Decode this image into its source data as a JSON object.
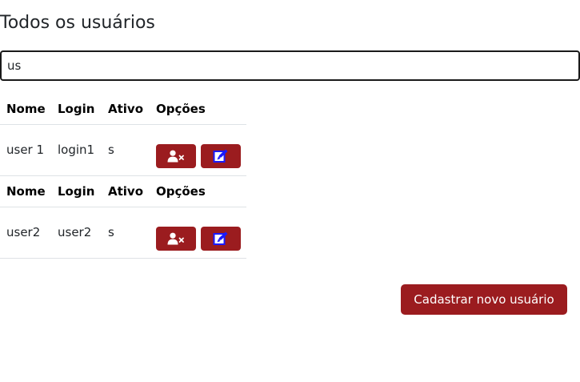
{
  "page": {
    "title": "Todos os usuários"
  },
  "search": {
    "value": "us"
  },
  "tables": [
    {
      "headers": [
        "Nome",
        "Login",
        "Ativo",
        "Opções"
      ],
      "row": {
        "nome": "user 1",
        "login": "login1",
        "ativo": "s"
      }
    },
    {
      "headers": [
        "Nome",
        "Login",
        "Ativo",
        "Opções"
      ],
      "row": {
        "nome": "user2",
        "login": "user2",
        "ativo": "s"
      }
    }
  ],
  "icons": {
    "delete": "user-remove-icon",
    "edit": "edit-icon"
  },
  "colors": {
    "accent": "#9b1c1f",
    "edit_icon": "#1a1aff",
    "border": "#dee2e6"
  },
  "actions": {
    "add_user_label": "Cadastrar novo usuário"
  }
}
